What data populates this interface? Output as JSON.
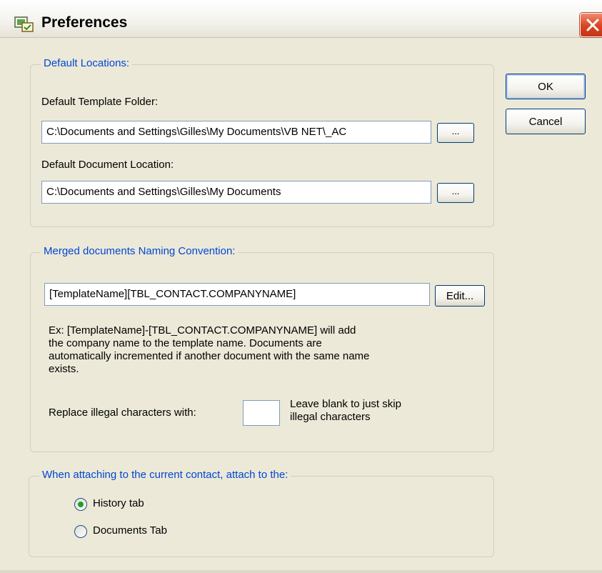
{
  "window": {
    "title": "Preferences"
  },
  "buttons": {
    "ok": "OK",
    "cancel": "Cancel"
  },
  "default_locations": {
    "legend": "Default Locations:",
    "template_label": "Default Template Folder:",
    "template_value": "C:\\Documents and Settings\\Gilles\\My Documents\\VB NET\\_AC",
    "template_browse": "...",
    "document_label": "Default Document Location:",
    "document_value": "C:\\Documents and Settings\\Gilles\\My Documents",
    "document_browse": "..."
  },
  "naming": {
    "legend": "Merged documents Naming Convention:",
    "value": "[TemplateName][TBL_CONTACT.COMPANYNAME]",
    "edit_button": "Edit...",
    "example_lines": [
      "Ex: [TemplateName]-[TBL_CONTACT.COMPANYNAME] will add",
      "the company name to the template name. Documents are",
      "automatically incremented if another document with the same name",
      "exists."
    ],
    "replace_label": "Replace illegal characters with:",
    "replace_value": "",
    "hint_lines": [
      "Leave blank to just skip",
      "illegal characters"
    ]
  },
  "attach": {
    "legend": "When attaching to the current contact, attach to the:",
    "options": [
      {
        "label": "History tab",
        "selected": true
      },
      {
        "label": "Documents Tab",
        "selected": false
      }
    ]
  },
  "colors": {
    "dialog_bg": "#ece9d8",
    "legend_text": "#0046d5",
    "close_button": "#d8441e",
    "radio_selected": "#21a121"
  },
  "icons": {
    "title": "preferences-app-icon",
    "close": "close-icon"
  }
}
